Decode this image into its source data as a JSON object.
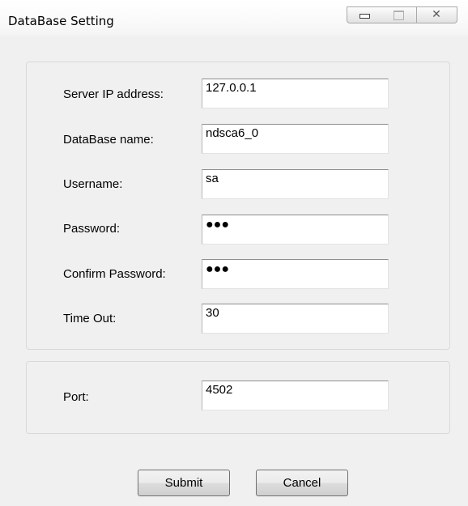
{
  "window": {
    "title": "DataBase Setting",
    "controls": {
      "minimize_icon": "minimize-icon",
      "maximize_icon": "maximize-icon",
      "close_icon": "close-icon",
      "close_glyph": "✕"
    }
  },
  "form": {
    "fields": [
      {
        "label": "Server IP address:",
        "value": "127.0.0.1",
        "type": "text"
      },
      {
        "label": "DataBase name:",
        "value": "ndsca6_0",
        "type": "text"
      },
      {
        "label": "Username:",
        "value": "sa",
        "type": "text"
      },
      {
        "label": "Password:",
        "value": "●●●",
        "type": "password"
      },
      {
        "label": "Confirm Password:",
        "value": "●●●",
        "type": "password"
      },
      {
        "label": "Time Out:",
        "value": "30",
        "type": "text"
      }
    ],
    "port": {
      "label": "Port:",
      "value": "4502"
    }
  },
  "buttons": {
    "submit": "Submit",
    "cancel": "Cancel"
  },
  "colors": {
    "window_bg": "#f0f0f0",
    "field_bg": "#ffffff",
    "group_border": "#d9d9d9"
  }
}
